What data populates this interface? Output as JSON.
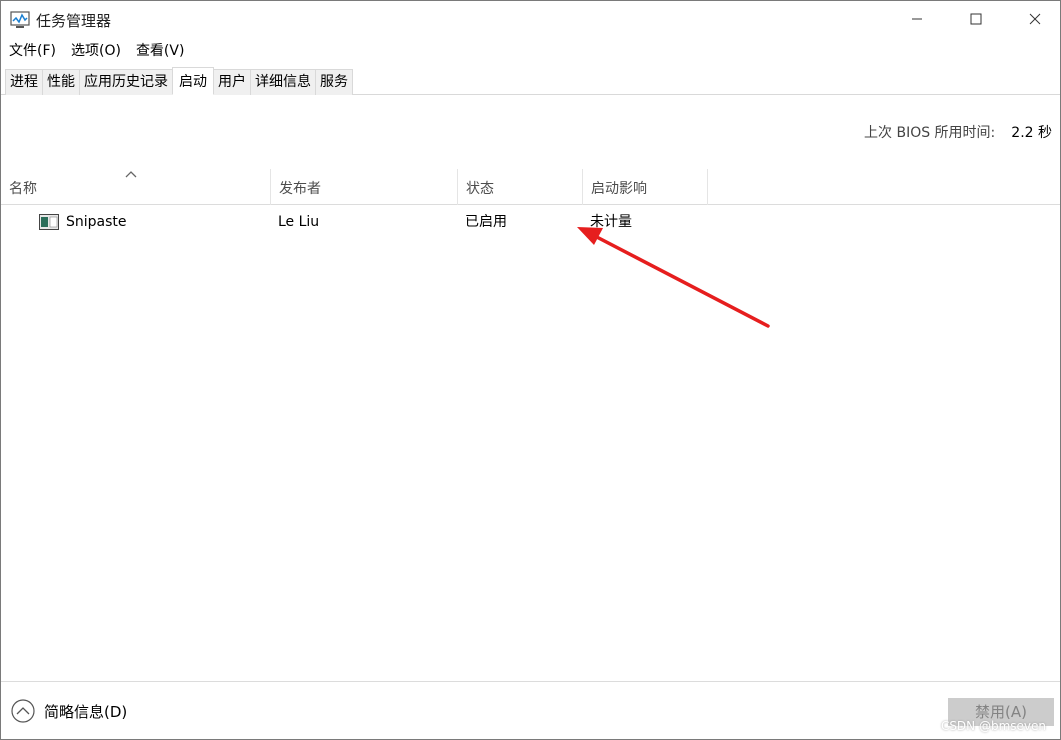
{
  "window": {
    "title": "任务管理器",
    "icons": {
      "app": "task-manager-icon",
      "minimize": "minimize-icon",
      "maximize": "maximize-icon",
      "close": "close-icon"
    }
  },
  "menu": {
    "items": [
      {
        "label": "文件(F)"
      },
      {
        "label": "选项(O)"
      },
      {
        "label": "查看(V)"
      }
    ]
  },
  "tabs": [
    {
      "label": "进程",
      "active": false
    },
    {
      "label": "性能",
      "active": false
    },
    {
      "label": "应用历史记录",
      "active": false
    },
    {
      "label": "启动",
      "active": true
    },
    {
      "label": "用户",
      "active": false
    },
    {
      "label": "详细信息",
      "active": false
    },
    {
      "label": "服务",
      "active": false
    }
  ],
  "bios": {
    "label": "上次 BIOS 所用时间:",
    "value": "2.2 秒"
  },
  "table": {
    "columns": [
      {
        "label": "名称",
        "sorted": "ascending"
      },
      {
        "label": "发布者"
      },
      {
        "label": "状态"
      },
      {
        "label": "启动影响"
      }
    ],
    "rows": [
      {
        "name": "Snipaste",
        "publisher": "Le Liu",
        "status": "已启用",
        "impact": "未计量",
        "icon": "snipaste-app-icon"
      }
    ]
  },
  "annotation": {
    "color": "#e61e1e",
    "icon": "red-arrow-annotation"
  },
  "footer": {
    "brief_label": "简略信息(D)",
    "brief_icon": "chevron-up-circle-icon",
    "disable_label": "禁用(A)"
  },
  "watermark": "CSDN @bmseven",
  "colors": {
    "accent": "#0078d7",
    "button_disabled_bg": "#cccccc",
    "button_disabled_text": "#838383"
  }
}
